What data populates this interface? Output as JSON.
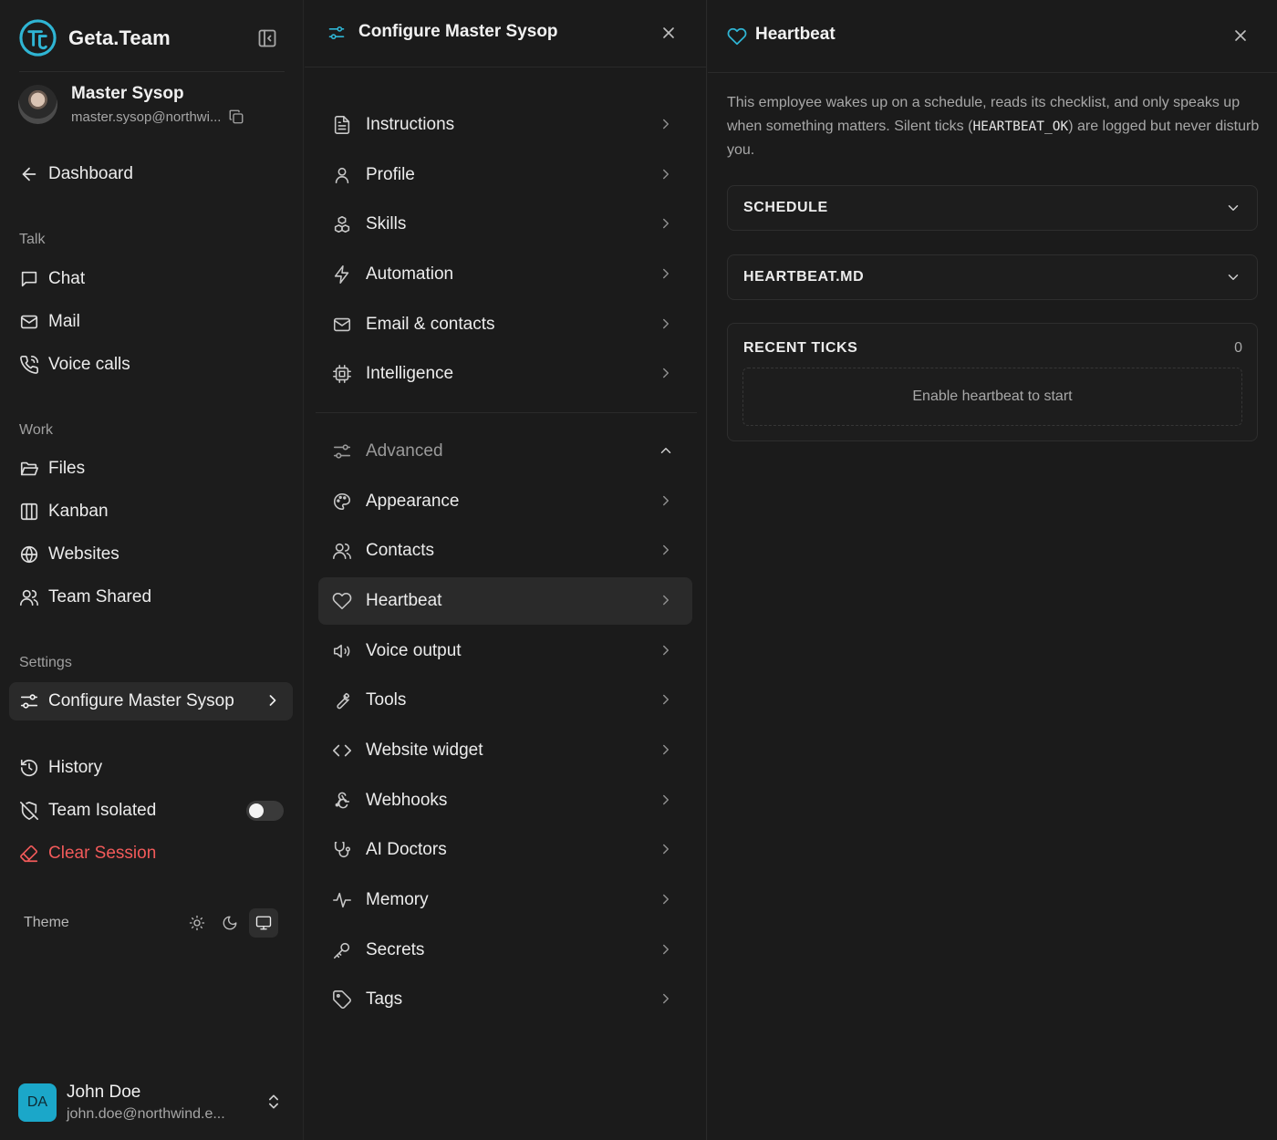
{
  "brand": {
    "name": "Geta.Team",
    "accent": "#2fb5d4"
  },
  "user": {
    "name": "Master Sysop",
    "email": "master.sysop@northwi..."
  },
  "nav": {
    "dashboard": "Dashboard",
    "talk_label": "Talk",
    "chat": "Chat",
    "mail": "Mail",
    "voice_calls": "Voice calls",
    "work_label": "Work",
    "files": "Files",
    "kanban": "Kanban",
    "websites": "Websites",
    "team_shared": "Team Shared",
    "settings_label": "Settings",
    "configure": "Configure Master Sysop",
    "history": "History",
    "team_isolated": "Team Isolated",
    "team_isolated_enabled": false,
    "clear_session": "Clear Session",
    "theme_label": "Theme",
    "theme_active": "system"
  },
  "footer_user": {
    "initials": "DA",
    "name": "John Doe",
    "email": "john.doe@northwind.e..."
  },
  "config_panel": {
    "title": "Configure Master Sysop",
    "items": [
      "Instructions",
      "Profile",
      "Skills",
      "Automation",
      "Email & contacts",
      "Intelligence"
    ],
    "advanced_label": "Advanced",
    "advanced_items": [
      "Appearance",
      "Contacts",
      "Heartbeat",
      "Voice output",
      "Tools",
      "Website widget",
      "Webhooks",
      "AI Doctors",
      "Memory",
      "Secrets",
      "Tags"
    ],
    "active_item": "Heartbeat"
  },
  "heartbeat": {
    "title": "Heartbeat",
    "desc_part1": "This employee wakes up on a schedule, reads its checklist, and only speaks up when something matters. Silent ticks (",
    "desc_code": "HEARTBEAT_OK",
    "desc_part2": ") are logged but never disturb you.",
    "schedule_label": "SCHEDULE",
    "heartbeat_md_label": "HEARTBEAT.MD",
    "recent_ticks_label": "RECENT TICKS",
    "recent_ticks_count": "0",
    "empty_state": "Enable heartbeat to start"
  },
  "colors": {
    "danger": "#f25a5a",
    "avatar_bg": "#1ba7c9"
  }
}
